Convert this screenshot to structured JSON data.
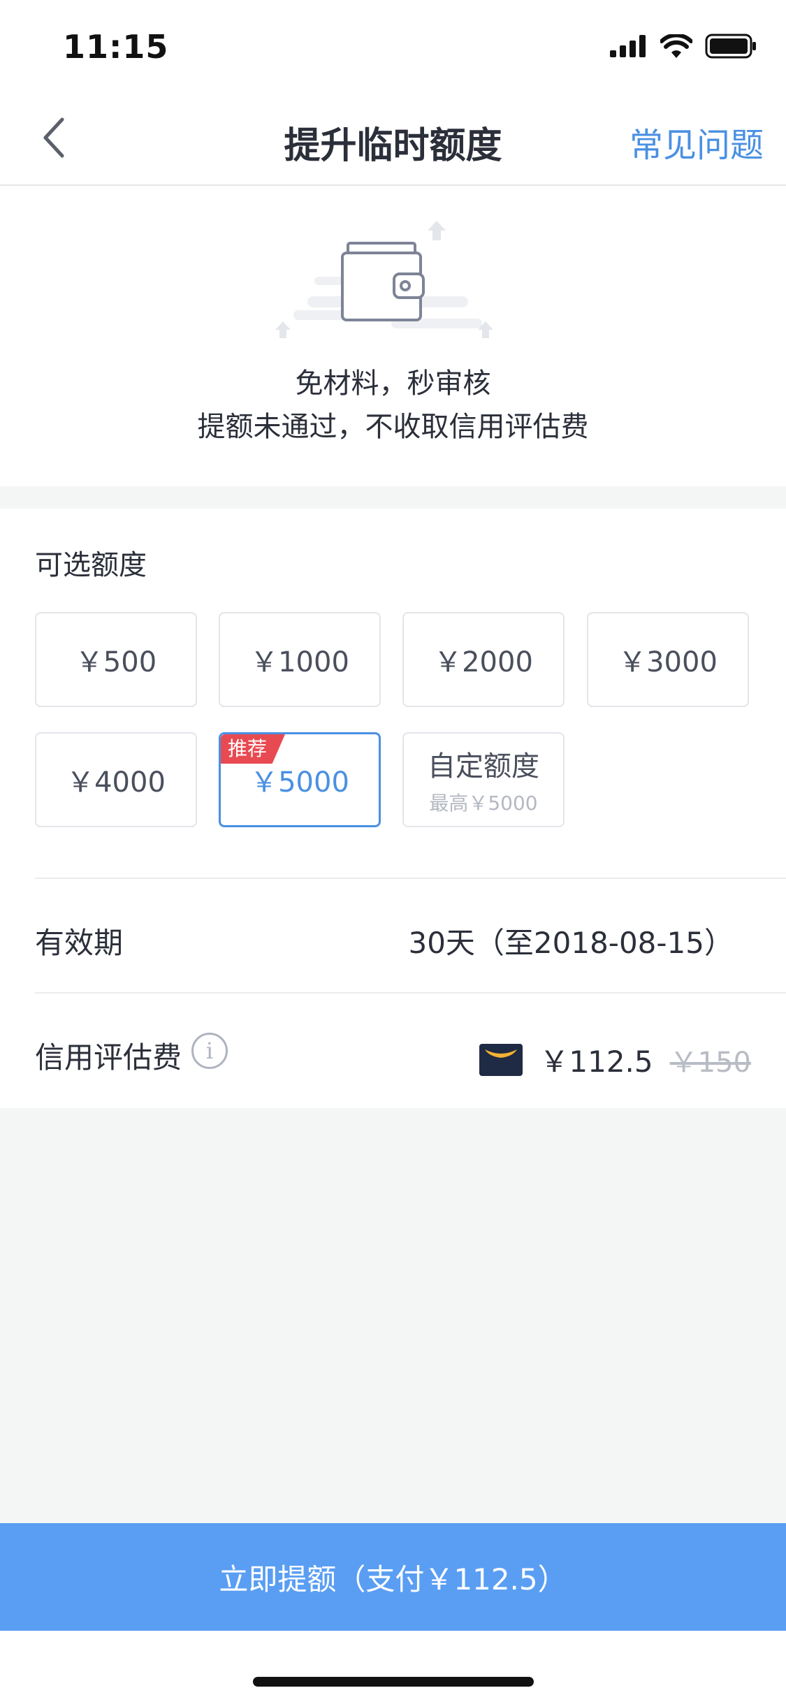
{
  "status_bar": {
    "time": "11:15"
  },
  "nav": {
    "title": "提升临时额度",
    "faq_link": "常见问题"
  },
  "hero": {
    "line1": "免材料，秒审核",
    "line2": "提额未通过，不收取信用评估费"
  },
  "options": {
    "title": "可选额度",
    "items": [
      {
        "label": "￥500"
      },
      {
        "label": "￥1000"
      },
      {
        "label": "￥2000"
      },
      {
        "label": "￥3000"
      },
      {
        "label": "￥4000"
      },
      {
        "label": "￥5000",
        "selected": true,
        "tag": "推荐"
      },
      {
        "label": "自定额度",
        "sub": "最高￥5000"
      }
    ]
  },
  "validity": {
    "label": "有效期",
    "value": "30天（至2018-08-15）"
  },
  "fee": {
    "label": "信用评估费",
    "info_icon": "i",
    "price": "￥112.5",
    "original_price": "￥150"
  },
  "cta": {
    "label": "立即提额（支付￥112.5）"
  },
  "colors": {
    "accent": "#4a90e2",
    "cta_bg": "#5a9ef3",
    "tag_bg": "#e84a52"
  }
}
